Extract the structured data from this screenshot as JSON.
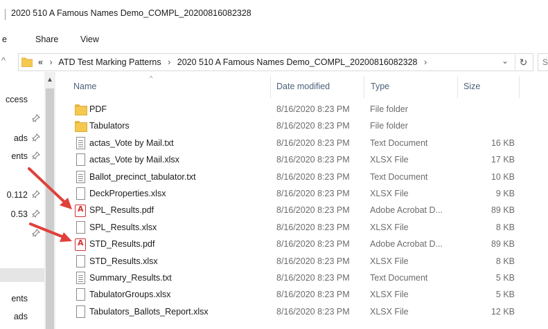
{
  "window": {
    "title": "2020 510 A Famous Names Demo_COMPL_20200816082328"
  },
  "ribbon": {
    "tabs": [
      {
        "label": "e"
      },
      {
        "label": "Share"
      },
      {
        "label": "View"
      }
    ]
  },
  "address": {
    "nav_back_glyph": "^",
    "overflow": "«",
    "crumbs": [
      "ATD Test Marking Patterns",
      "2020 510 A Famous Names Demo_COMPL_20200816082328"
    ],
    "search_glyph": "S"
  },
  "nav": {
    "items": [
      {
        "label": "ccess",
        "pinned": false,
        "selected": false
      },
      {
        "label": "",
        "pinned": true,
        "selected": false
      },
      {
        "label": "ads",
        "pinned": true,
        "selected": false
      },
      {
        "label": "ents",
        "pinned": true,
        "selected": false
      },
      {
        "label": "",
        "pinned": false,
        "selected": false
      },
      {
        "label": "0.112",
        "pinned": true,
        "selected": false
      },
      {
        "label": "0.53",
        "pinned": true,
        "selected": false
      },
      {
        "label": "",
        "pinned": true,
        "selected": false
      },
      {
        "label": "",
        "pinned": false,
        "selected": false
      },
      {
        "label": "",
        "pinned": false,
        "selected": true
      },
      {
        "label": "ents",
        "pinned": false,
        "selected": false
      },
      {
        "label": "ads",
        "pinned": false,
        "selected": false
      }
    ]
  },
  "columns": {
    "name": "Name",
    "date": "Date modified",
    "type": "Type",
    "size": "Size"
  },
  "files": [
    {
      "name": "PDF",
      "date": "8/16/2020 8:23 PM",
      "type": "File folder",
      "size": "",
      "icon": "folder-icon"
    },
    {
      "name": "Tabulators",
      "date": "8/16/2020 8:23 PM",
      "type": "File folder",
      "size": "",
      "icon": "folder-icon"
    },
    {
      "name": "actas_Vote by Mail.txt",
      "date": "8/16/2020 8:23 PM",
      "type": "Text Document",
      "size": "16 KB",
      "icon": "text-file-icon"
    },
    {
      "name": "actas_Vote by Mail.xlsx",
      "date": "8/16/2020 8:23 PM",
      "type": "XLSX File",
      "size": "17 KB",
      "icon": "blank-file-icon"
    },
    {
      "name": "Ballot_precinct_tabulator.txt",
      "date": "8/16/2020 8:23 PM",
      "type": "Text Document",
      "size": "10 KB",
      "icon": "text-file-icon"
    },
    {
      "name": "DeckProperties.xlsx",
      "date": "8/16/2020 8:23 PM",
      "type": "XLSX File",
      "size": "9 KB",
      "icon": "blank-file-icon"
    },
    {
      "name": "SPL_Results.pdf",
      "date": "8/16/2020 8:23 PM",
      "type": "Adobe Acrobat D...",
      "size": "89 KB",
      "icon": "pdf-icon"
    },
    {
      "name": "SPL_Results.xlsx",
      "date": "8/16/2020 8:23 PM",
      "type": "XLSX File",
      "size": "8 KB",
      "icon": "blank-file-icon"
    },
    {
      "name": "STD_Results.pdf",
      "date": "8/16/2020 8:23 PM",
      "type": "Adobe Acrobat D...",
      "size": "89 KB",
      "icon": "pdf-icon"
    },
    {
      "name": "STD_Results.xlsx",
      "date": "8/16/2020 8:23 PM",
      "type": "XLSX File",
      "size": "8 KB",
      "icon": "blank-file-icon"
    },
    {
      "name": "Summary_Results.txt",
      "date": "8/16/2020 8:23 PM",
      "type": "Text Document",
      "size": "5 KB",
      "icon": "text-file-icon"
    },
    {
      "name": "TabulatorGroups.xlsx",
      "date": "8/16/2020 8:23 PM",
      "type": "XLSX File",
      "size": "5 KB",
      "icon": "blank-file-icon"
    },
    {
      "name": "Tabulators_Ballots_Report.xlsx",
      "date": "8/16/2020 8:23 PM",
      "type": "XLSX File",
      "size": "12 KB",
      "icon": "blank-file-icon"
    }
  ],
  "annotation": {
    "arrow_color": "#e0403a"
  }
}
